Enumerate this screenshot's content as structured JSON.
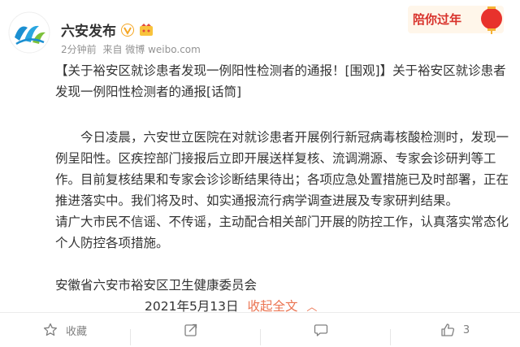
{
  "account": {
    "name": "六安发布",
    "avatar_icon": "liuan-logo-icon"
  },
  "meta": {
    "time": "2分钟前",
    "source": "来自 微博 weibo.com"
  },
  "banner": {
    "text": "陪你过年"
  },
  "post": {
    "headline": "【关于裕安区就诊患者发现一例阳性检测者的通报！[围观]】关于裕安区就诊患者发现一例阳性检测者的通报[话筒]",
    "paragraph1": "今日凌晨，六安世立医院在对就诊患者开展例行新冠病毒核酸检测时，发现一例呈阳性。区疾控部门接报后立即开展送样复核、流调溯源、专家会诊研判等工作。目前复核结果和专家会诊诊断结果待出；各项应急处置措施已及时部署，正在推进落实中。我们将及时、如实通报流行病学调查进展及专家研判结果。",
    "paragraph2": "请广大市民不信谣、不传谣，主动配合相关部门开展的防控工作，认真落实常态化个人防控各项措施。",
    "signature": "安徽省六安市裕安区卫生健康委员会",
    "date": "2021年5月13日",
    "collapse_label": "收起全文"
  },
  "actions": [
    {
      "label": "收藏",
      "icon": "star-icon"
    },
    {
      "label": "",
      "icon": "share-icon"
    },
    {
      "label": "",
      "icon": "comment-icon"
    },
    {
      "label": "3",
      "icon": "like-icon"
    }
  ],
  "colors": {
    "accent": "#eb7350",
    "text": "#333333",
    "meta": "#939393"
  }
}
